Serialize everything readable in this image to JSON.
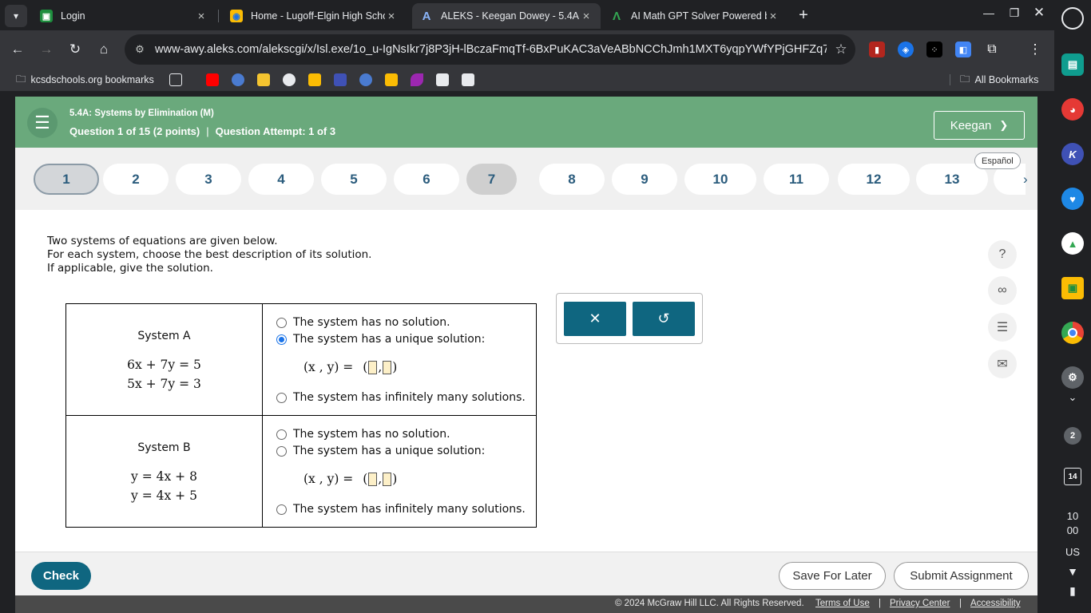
{
  "tabs": [
    {
      "title": "Login",
      "favicon": "classroom-icon",
      "active": false
    },
    {
      "title": "Home - Lugoff-Elgin High Scho",
      "favicon": "school-icon",
      "active": false
    },
    {
      "title": "ALEKS - Keegan Dowey - 5.4A:",
      "favicon": "aleks-icon",
      "active": true
    },
    {
      "title": "AI Math GPT Solver Powered b",
      "favicon": "mathgpt-icon",
      "active": false
    }
  ],
  "url": "www-awy.aleks.com/alekscgi/x/Isl.exe/1o_u-IgNsIkr7j8P3jH-lBczaFmqTf-6BxPuKAC3aVeABbNCChJmh1MXT6yqpYWfYPjGHFZq7f...",
  "bookmarks": {
    "folder_label": "kcsdschools.org bookmarks",
    "all_label": "All Bookmarks"
  },
  "header": {
    "topic": "5.4A: Systems by Elimination (M)",
    "question_info": "Question 1 of 15 (2 points)",
    "separator": "|",
    "attempt_info": "Question Attempt: 1 of 3",
    "user_name": "Keegan"
  },
  "question_nav": {
    "numbers": [
      "1",
      "2",
      "3",
      "4",
      "5",
      "6",
      "7",
      "8",
      "9",
      "10",
      "11",
      "12",
      "13"
    ],
    "current": "1",
    "flagged": "7",
    "espanol_label": "Español"
  },
  "instructions": [
    "Two systems of equations are given below.",
    "For each system, choose the best description of its solution.",
    "If applicable, give the solution."
  ],
  "systems": [
    {
      "name": "System A",
      "equations": [
        "6x + 7y = 5",
        "5x + 7y = 3"
      ],
      "options": [
        "The system has no solution.",
        "The system has a unique solution:",
        "The system has infinitely many solutions."
      ],
      "selected": 1,
      "solution_label": "(x , y) ="
    },
    {
      "name": "System B",
      "equations": [
        "y = 4x + 8",
        "y = 4x + 5"
      ],
      "options": [
        "The system has no solution.",
        "The system has a unique solution:",
        "The system has infinitely many solutions."
      ],
      "selected": null,
      "solution_label": "(x , y) ="
    }
  ],
  "tools": {
    "clear_icon": "x-icon",
    "undo_icon": "undo-icon"
  },
  "side_tools": [
    "help-icon",
    "glasses-icon",
    "notes-icon",
    "mail-icon"
  ],
  "buttons": {
    "check": "Check",
    "save": "Save For Later",
    "submit": "Submit Assignment"
  },
  "footer": {
    "copyright": "© 2024 McGraw Hill LLC. All Rights Reserved.",
    "terms": "Terms of Use",
    "privacy": "Privacy Center",
    "accessibility": "Accessibility",
    "sep": "|"
  },
  "shelf": {
    "notification_count": "2",
    "calendar_day": "14",
    "time_hour": "10",
    "time_minute": "00",
    "locale": "US"
  },
  "colors": {
    "aleks_green": "#6aa97c",
    "aleks_teal": "#0f6680",
    "nav_blue": "#2b5c7d"
  }
}
